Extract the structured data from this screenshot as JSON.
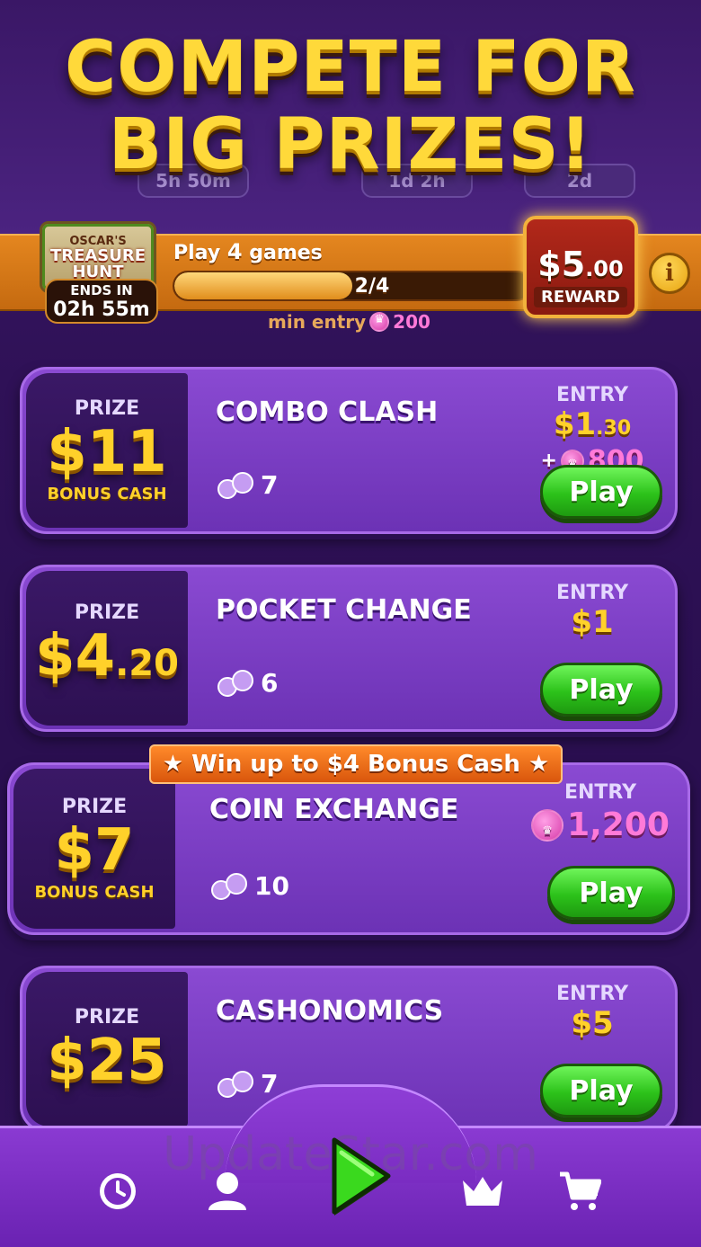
{
  "header": {
    "headline_line1": "COMPETE FOR",
    "headline_line2": "BIG PRIZES!",
    "background_timers": [
      "5h 50m",
      "1d 2h",
      "2d"
    ]
  },
  "treasure_hunt": {
    "badge_line1": "OSCAR'S",
    "badge_line2": "TREASURE HUNT",
    "ends_in_label": "ENDS IN",
    "ends_in_value": "02h 55m",
    "task_prefix": "Play",
    "task_count": "4",
    "task_suffix": "games",
    "progress_text": "2/4",
    "progress_fraction": 0.5,
    "min_entry_label": "min entry",
    "min_entry_value": "200",
    "reward_amount_main": "$5",
    "reward_amount_cents": ".00",
    "reward_label": "REWARD",
    "info_label": "i"
  },
  "tournaments": [
    {
      "prize_label": "PRIZE",
      "prize_main": "$11",
      "prize_cents": "",
      "prize_sub": "BONUS CASH",
      "name": "COMBO CLASH",
      "players": "7",
      "entry_label": "ENTRY",
      "entry_cash_main": "$1",
      "entry_cash_cents": ".30",
      "entry_gems": "800",
      "play_label": "Play"
    },
    {
      "prize_label": "PRIZE",
      "prize_main": "$4",
      "prize_cents": ".20",
      "prize_sub": "",
      "name": "POCKET CHANGE",
      "players": "6",
      "entry_label": "ENTRY",
      "entry_cash_main": "$1",
      "entry_cash_cents": "",
      "entry_gems": "",
      "play_label": "Play"
    },
    {
      "ribbon": "★ Win up to $4 Bonus Cash ★",
      "prize_label": "PRIZE",
      "prize_main": "$7",
      "prize_cents": "",
      "prize_sub": "BONUS CASH",
      "name": "COIN EXCHANGE",
      "players": "10",
      "entry_label": "ENTRY",
      "entry_gems": "1,200",
      "play_label": "Play"
    },
    {
      "prize_label": "PRIZE",
      "prize_main": "$25",
      "prize_cents": "",
      "prize_sub": "",
      "name": "CASHONOMICS",
      "players": "7",
      "entry_label": "ENTRY",
      "entry_cash_main": "$5",
      "entry_cash_cents": "",
      "play_label": "Play"
    }
  ],
  "nav": {
    "items": [
      "clock-icon",
      "profile-icon",
      "play-icon",
      "crown-icon",
      "cart-icon"
    ]
  },
  "watermark": "UpdateStar.com"
}
